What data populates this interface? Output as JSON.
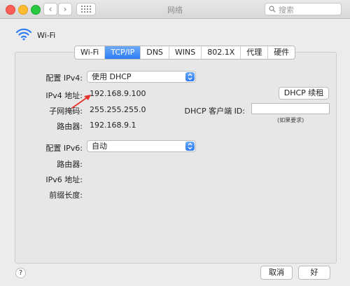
{
  "window": {
    "title": "网络"
  },
  "search": {
    "placeholder": "搜索"
  },
  "header": {
    "wifi_label": "Wi-Fi"
  },
  "tabs": [
    "Wi-Fi",
    "TCP/IP",
    "DNS",
    "WINS",
    "802.1X",
    "代理",
    "硬件"
  ],
  "ipv4": {
    "config_label": "配置 IPv4:",
    "config_value": "使用 DHCP",
    "address_label": "IPv4 地址:",
    "address_value": "192.168.9.100",
    "subnet_label": "子网掩码:",
    "subnet_value": "255.255.255.0",
    "router_label": "路由器:",
    "router_value": "192.168.9.1",
    "renew_button": "DHCP 续租",
    "client_id_label": "DHCP 客户端 ID:",
    "client_id_value": "",
    "client_id_hint": "(如果要求)"
  },
  "ipv6": {
    "config_label": "配置 IPv6:",
    "config_value": "自动",
    "router_label": "路由器:",
    "address_label": "IPv6 地址:",
    "prefix_label": "前缀长度:"
  },
  "footer": {
    "help": "?",
    "cancel": "取消",
    "ok": "好"
  },
  "colors": {
    "accent": "#2f7ef5",
    "arrow": "#e8322b"
  }
}
